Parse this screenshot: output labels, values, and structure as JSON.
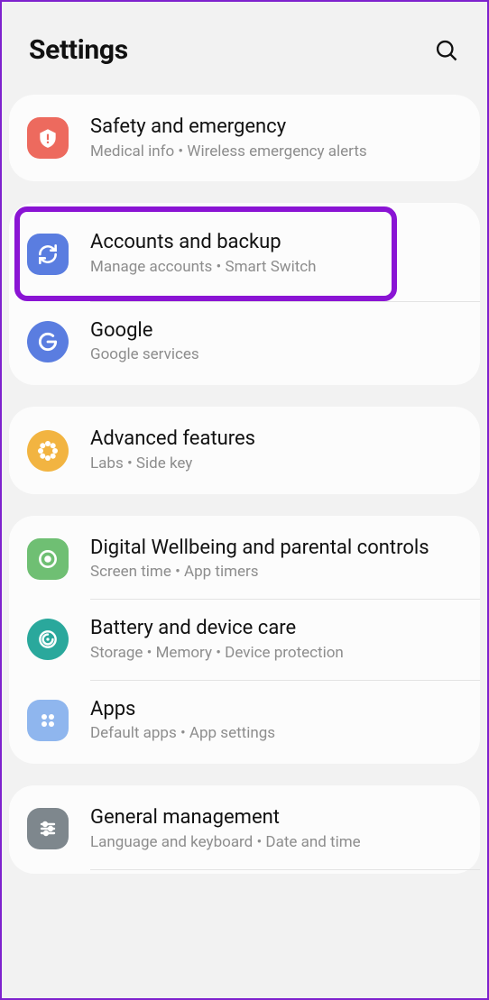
{
  "header": {
    "title": "Settings"
  },
  "groups": [
    {
      "items": [
        {
          "title": "Safety and emergency",
          "sub": "Medical info  •  Wireless emergency alerts"
        }
      ]
    },
    {
      "items": [
        {
          "title": "Accounts and backup",
          "sub": "Manage accounts  •  Smart Switch"
        },
        {
          "title": "Google",
          "sub": "Google services"
        }
      ]
    },
    {
      "items": [
        {
          "title": "Advanced features",
          "sub": "Labs  •  Side key"
        }
      ]
    },
    {
      "items": [
        {
          "title": "Digital Wellbeing and parental controls",
          "sub": "Screen time  •  App timers"
        },
        {
          "title": "Battery and device care",
          "sub": "Storage  •  Memory  •  Device protection"
        },
        {
          "title": "Apps",
          "sub": "Default apps  •  App settings"
        }
      ]
    },
    {
      "items": [
        {
          "title": "General management",
          "sub": "Language and keyboard  •  Date and time"
        }
      ]
    }
  ]
}
